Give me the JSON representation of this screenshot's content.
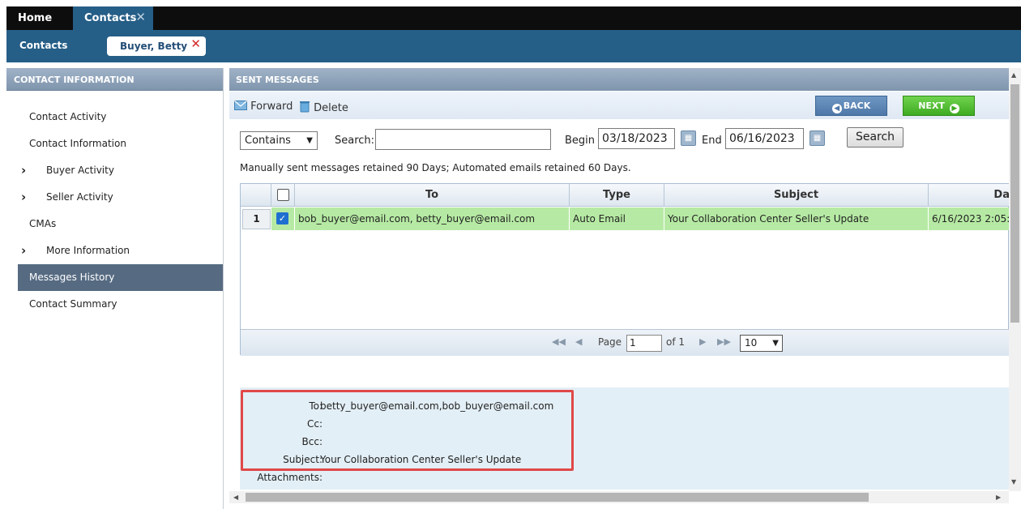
{
  "tabs": {
    "home": "Home",
    "contacts": "Contacts",
    "close": "✕"
  },
  "subbar": {
    "label": "Contacts",
    "chip": "Buyer, Betty",
    "chip_close": "✕"
  },
  "left": {
    "header": "CONTACT INFORMATION",
    "items": [
      {
        "label": "Contact Activity"
      },
      {
        "label": "Contact Information"
      },
      {
        "label": "Buyer Activity"
      },
      {
        "label": "Seller Activity"
      },
      {
        "label": "CMAs"
      },
      {
        "label": "More Information"
      },
      {
        "label": "Messages History"
      },
      {
        "label": "Contact Summary"
      }
    ]
  },
  "right": {
    "header": "SENT MESSAGES",
    "toolbar": {
      "forward": "Forward",
      "delete": "Delete",
      "back": "BACK",
      "next": "NEXT"
    },
    "filter": {
      "match": "Contains",
      "search_label": "Search:",
      "search_value": "",
      "begin_label": "Begin",
      "begin_value": "03/18/2023",
      "end_label": "End",
      "end_value": "06/16/2023",
      "search_button": "Search"
    },
    "note": "Manually sent messages retained 90 Days; Automated emails retained 60 Days.",
    "grid": {
      "columns": [
        "To",
        "Type",
        "Subject",
        "Da"
      ],
      "rows": [
        {
          "num": "1",
          "to": "bob_buyer@email.com, betty_buyer@email.com",
          "type": "Auto Email",
          "subject": "Your Collaboration Center Seller's Update",
          "date": "6/16/2023 2:05:"
        }
      ],
      "pager": {
        "page_label": "Page",
        "page_value": "1",
        "of_label": "of 1",
        "page_size": "10"
      }
    },
    "preview": {
      "to_label": "To:",
      "to_value": "betty_buyer@email.com,bob_buyer@email.com",
      "cc_label": "Cc:",
      "cc_value": "",
      "bcc_label": "Bcc:",
      "bcc_value": "",
      "subject_label": "Subject:",
      "subject_value": "Your Collaboration Center Seller's Update",
      "attachments_label": "Attachments:"
    }
  },
  "colors": {
    "accent": "#255e87",
    "selected_row": "#b6eaa4",
    "active_nav": "#566b82",
    "highlight_border": "#e04848"
  }
}
